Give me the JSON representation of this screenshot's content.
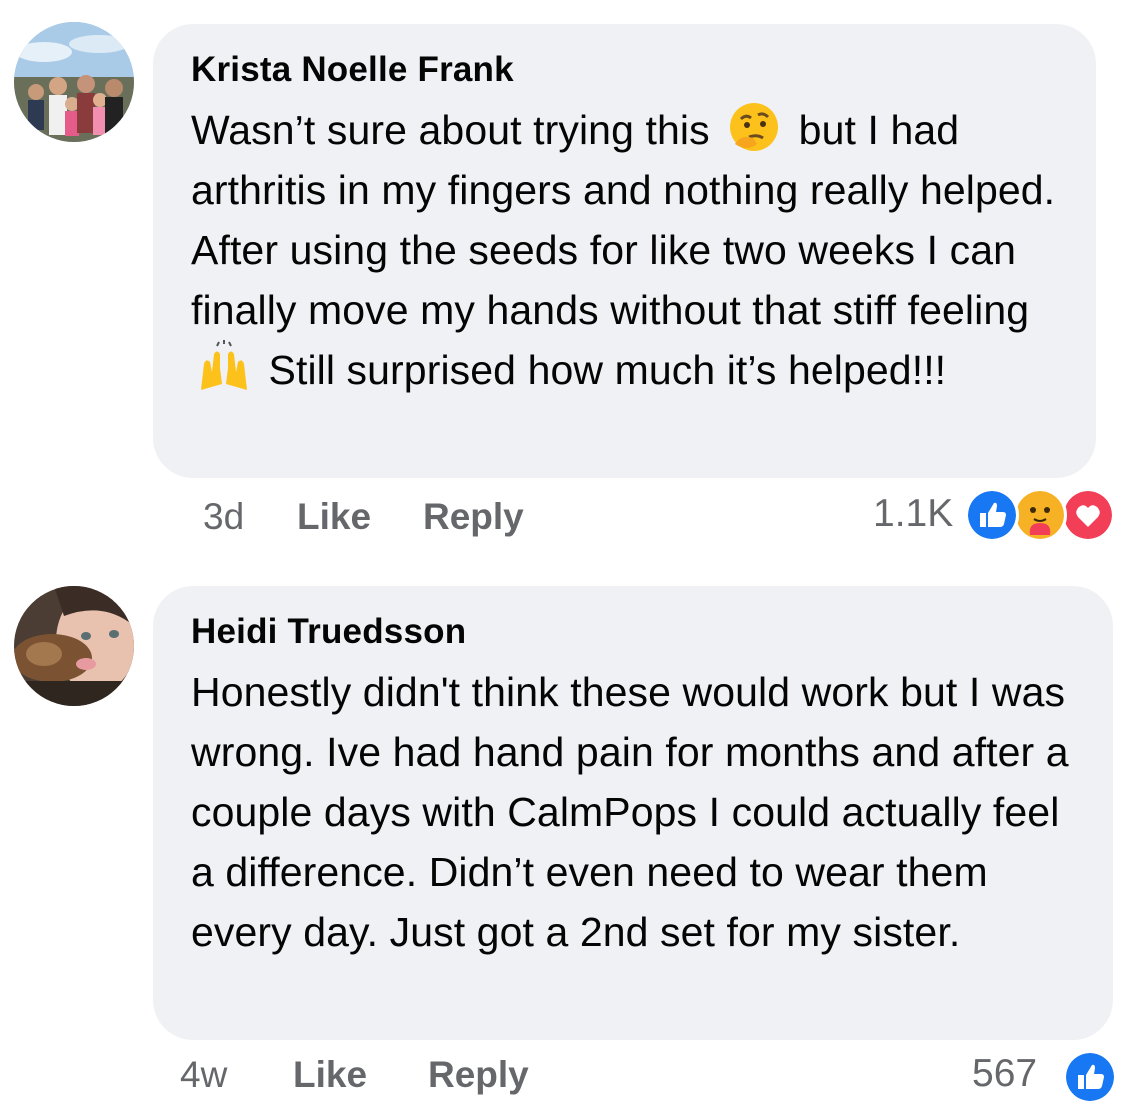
{
  "comments": [
    {
      "author": "Krista Noelle Frank",
      "text_parts": [
        "Wasn’t sure about trying this",
        "but I had arthritis in my fingers and nothing really helped. After using the seeds for like two weeks I can finally move my hands without that stiff feeling",
        "Still surprised how much it’s helped!!!"
      ],
      "time": "3d",
      "like_label": "Like",
      "reply_label": "Reply",
      "reaction_count": "1.1K",
      "reactions": [
        "like-icon",
        "care-icon",
        "love-icon"
      ],
      "inline_emojis": [
        "thinking-face-emoji",
        "raising-hands-emoji"
      ]
    },
    {
      "author": "Heidi Truedsson",
      "text": "Honestly didn't think these would work but I was wrong. Ive had hand pain for months and after a couple days with CalmPops I could actually feel a difference. Didn’t even need to wear them every day. Just got a 2nd set for my sister.",
      "time": "4w",
      "like_label": "Like",
      "reply_label": "Reply",
      "reaction_count": "567",
      "reactions": [
        "like-icon"
      ]
    }
  ],
  "colors": {
    "bubble": "#eff1f4",
    "meta_text": "#65676b",
    "like_blue": "#1877f2",
    "love_red": "#f33e58",
    "care_yellow": "#f7b125"
  }
}
